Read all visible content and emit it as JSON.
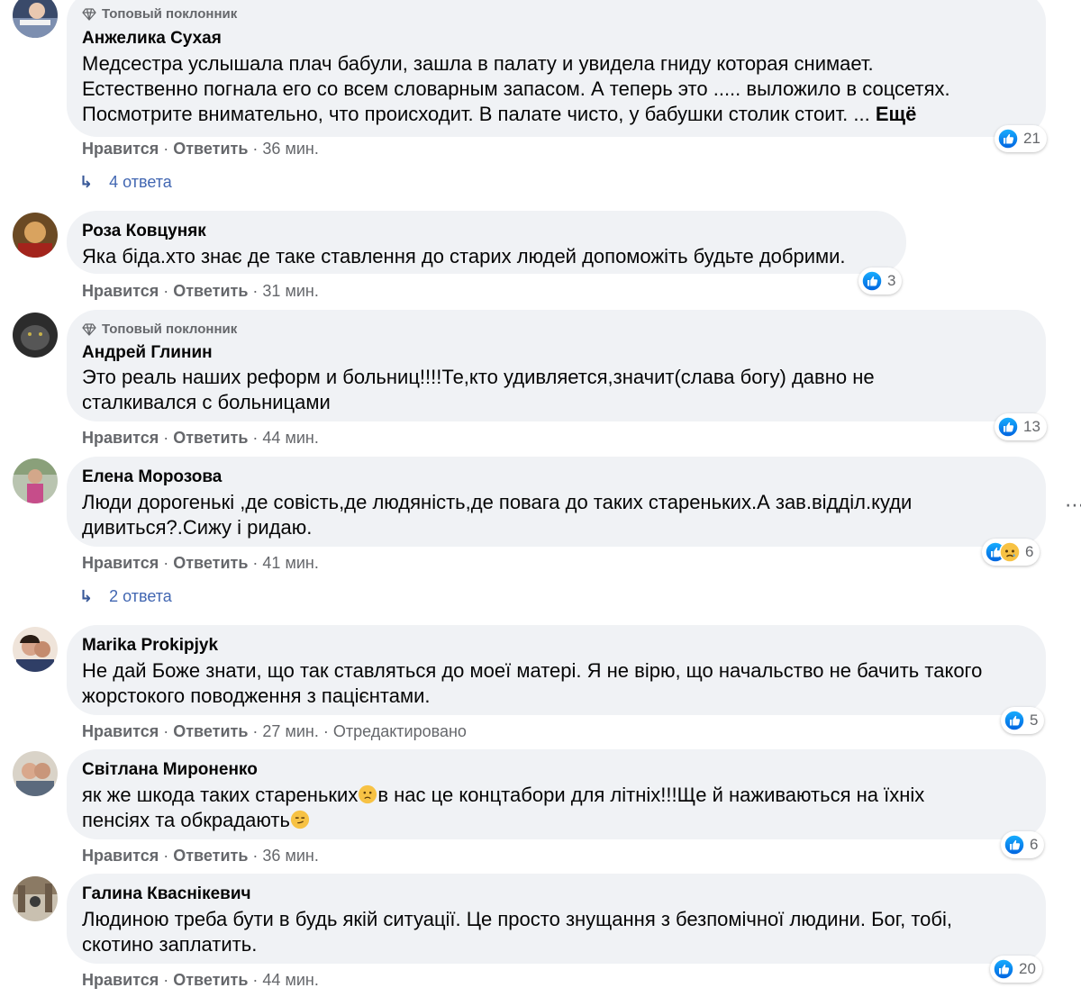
{
  "ui": {
    "top_fan_label": "Топовый поклонник",
    "like_label": "Нравится",
    "reply_label": "Ответить",
    "separator": "·",
    "more_label": "Ещё",
    "edited_label": "Отредактировано"
  },
  "comments": [
    {
      "author": "Анжелика Сухая",
      "top_fan": true,
      "text": "Медсестра услышала плач бабули, зашла в палату и увидела гниду которая снимает.\nЕстественно погнала его со всем словарным запасом. А теперь это ..... выложило в соцсетях.\nПосмотрите внимательно, что происходит. В палате чисто, у бабушки столик стоит. ...",
      "time": "36 мин.",
      "reactions": "21",
      "replies": "4 ответа"
    },
    {
      "author": "Роза Ковцуняк",
      "top_fan": false,
      "text": "Яка біда.хто знає де таке ставлення до старих людей допоможіть будьте добрими.",
      "time": "31 мин.",
      "reactions": "3"
    },
    {
      "author": "Андрей Глинин",
      "top_fan": true,
      "text": "Это реаль наших реформ и больниц!!!!Те,кто удивляется,значит(слава богу) давно не\nсталкивался с больницами",
      "time": "44 мин.",
      "reactions": "13"
    },
    {
      "author": "Елена Морозова",
      "top_fan": false,
      "text": "Люди дорогенькі ,де совість,де людяність,де повага до таких стареньких.А зав.відділ.куди\nдивиться?.Сижу і ридаю.",
      "time": "41 мин.",
      "reactions": "6",
      "replies": "2 ответа"
    },
    {
      "author": "Marika Prokipjyk",
      "top_fan": false,
      "text": "Не дай Боже знати, що так ставляться до моеї матері. Я не вірю, що начальство не бачить такого\nжорстокого поводження з пацієнтами.",
      "time": "27 мин.",
      "reactions": "5"
    },
    {
      "author": "Світлана Мироненко",
      "top_fan": false,
      "text_a": "як же шкода таких стареньких",
      "text_b": "в нас це концтабори для літніх!!!Ще й наживаються на їхніх",
      "text_c": "пенсіях та обкрадають",
      "time": "36 мин.",
      "reactions": "6"
    },
    {
      "author": "Галина Кваснікевич",
      "top_fan": false,
      "text": "Людиною треба бути в будь якій ситуації. Це просто знущання з безпомічної людини. Бог, тобі,\nскотино заплатить.",
      "time": "44 мин.",
      "reactions": "20"
    }
  ]
}
